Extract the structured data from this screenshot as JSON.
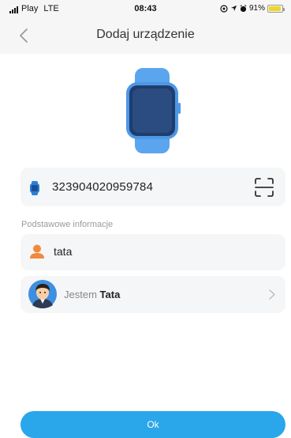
{
  "status_bar": {
    "carrier": "Play",
    "network": "LTE",
    "time": "08:43",
    "battery": "91%",
    "battery_level": 0.91,
    "icons": [
      "signal-icon",
      "location-icon",
      "navigation-icon",
      "alarm-icon",
      "battery-icon"
    ]
  },
  "header": {
    "title": "Dodaj urządzenie",
    "back_icon": "chevron-left-icon"
  },
  "device": {
    "image": "smartwatch-icon",
    "imei": "323904020959784",
    "scan_icon": "scan-icon"
  },
  "section": {
    "label": "Podstawowe informacje"
  },
  "profile": {
    "name": "tata",
    "relation_prefix": "Jestem",
    "relation_value": "Tata"
  },
  "actions": {
    "ok_label": "Ok"
  },
  "colors": {
    "accent": "#2aa6ea",
    "watch_band": "#5aa5ee",
    "person_icon": "#f08a3c",
    "card_bg": "#f5f6f8"
  }
}
